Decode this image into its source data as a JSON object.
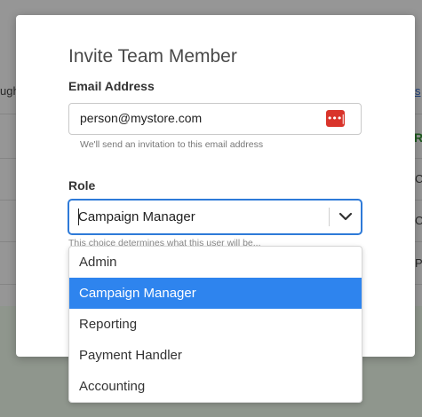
{
  "background": {
    "left_fragment": "ugh",
    "right_link_fragment": "s",
    "right_col_header": "R",
    "right_col_cells": [
      "C",
      "O",
      "P"
    ]
  },
  "modal": {
    "title": "Invite Team Member",
    "email": {
      "label": "Email Address",
      "value": "person@mystore.com",
      "helper": "We'll send an invitation to this email address",
      "password_manager_icon": "password-manager-icon"
    },
    "role": {
      "label": "Role",
      "selected": "Campaign Manager",
      "helper_fragment": "This choice determines what this user will be..."
    }
  },
  "dropdown": {
    "options": [
      "Admin",
      "Campaign Manager",
      "Reporting",
      "Payment Handler",
      "Accounting"
    ],
    "selected_index": 1
  },
  "colors": {
    "accent": "#2e84ee",
    "focus_border": "#2e7ad8",
    "pw_icon": "#d9342b"
  }
}
